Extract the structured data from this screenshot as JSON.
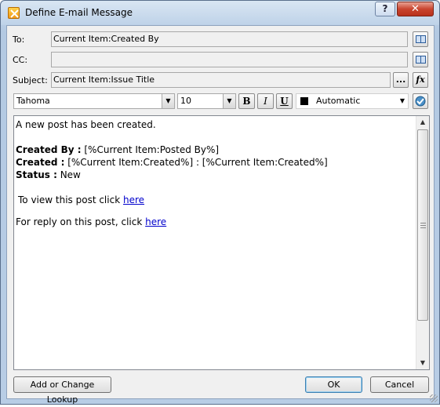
{
  "window": {
    "title": "Define E-mail Message"
  },
  "titlebar": {
    "help_label": "?",
    "close_label": "✕"
  },
  "fields": {
    "to_label": "To:",
    "to_value": "Current Item:Created By",
    "cc_label": "CC:",
    "cc_value": "",
    "subject_label": "Subject:",
    "subject_value": "Current Item:Issue Title",
    "subject_more_label": "...",
    "subject_fx_label": "fx"
  },
  "toolbar": {
    "font_name": "Tahoma",
    "font_size": "10",
    "bold_label": "B",
    "italic_label": "I",
    "underline_label": "U",
    "color_name": "Automatic",
    "color_swatch": "#000000"
  },
  "body": {
    "intro": "A new post has been created.",
    "created_by_label": "Created By :",
    "created_by_value": " [%Current Item:Posted By%]",
    "created_label": "Created :",
    "created_value": " [%Current Item:Created%] : [%Current Item:Created%]",
    "status_label": "Status :",
    "status_value": " New",
    "view_text": "To view this post click ",
    "view_link": "here",
    "reply_text": "For reply on this post, click ",
    "reply_link": "here"
  },
  "footer": {
    "lookup_label": "Add or Change Lookup",
    "ok_label": "OK",
    "cancel_label": "Cancel"
  },
  "icons": [
    "app-icon",
    "address-book-icon",
    "help-icon",
    "close-icon",
    "spellcheck-icon"
  ]
}
